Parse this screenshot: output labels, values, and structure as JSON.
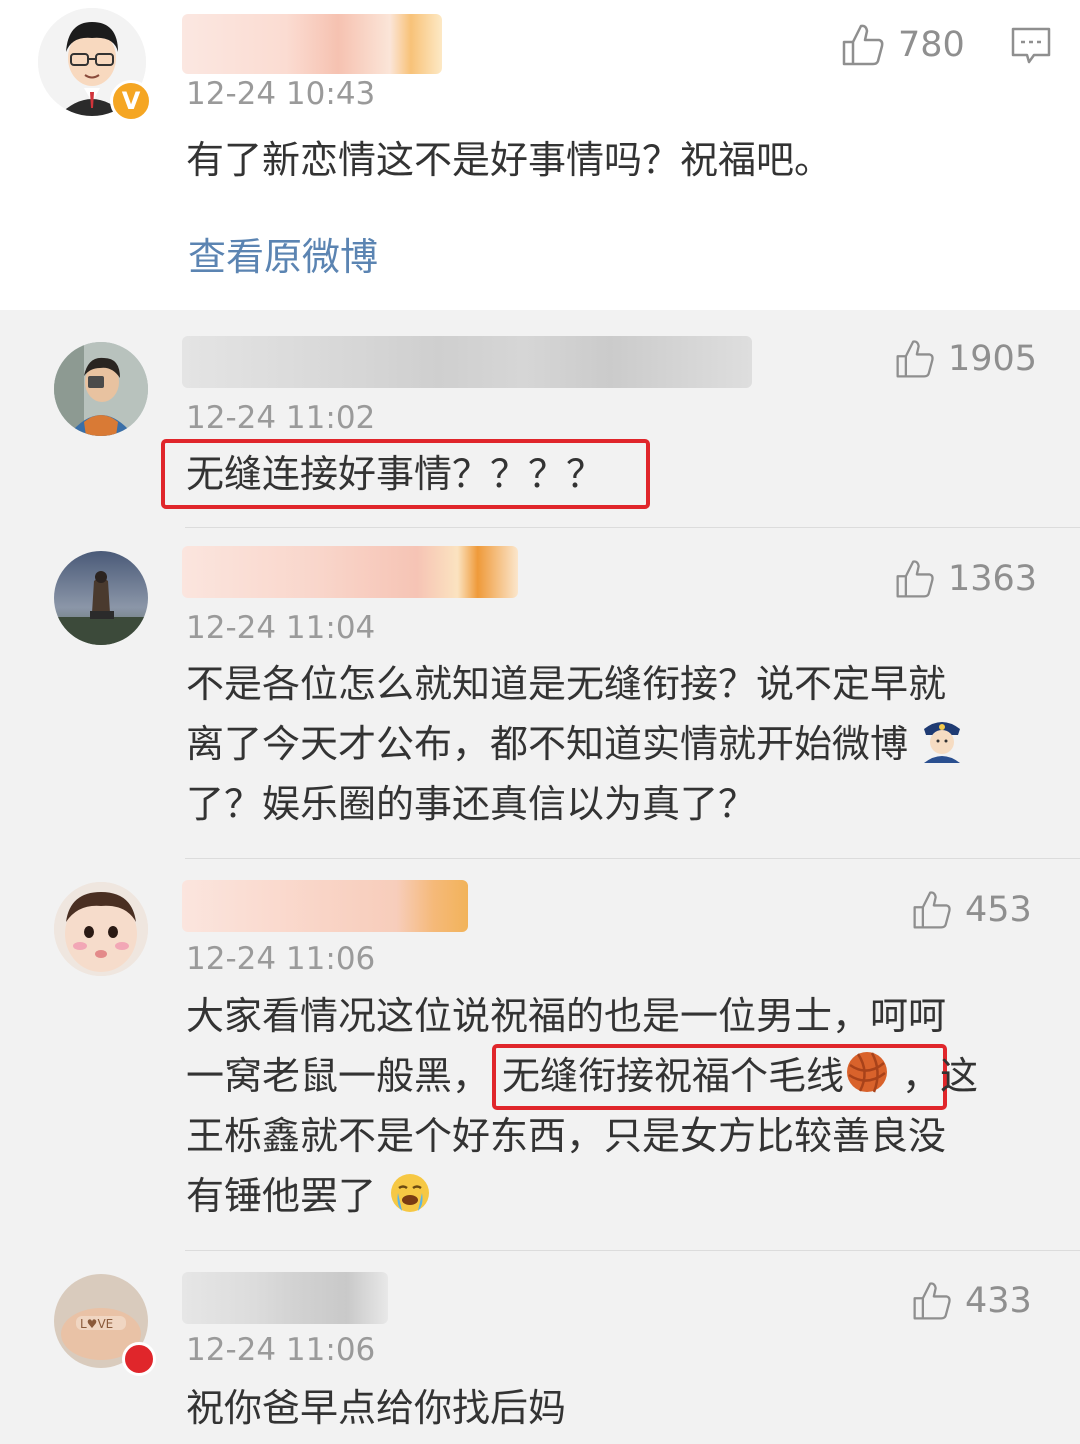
{
  "main_comment": {
    "timestamp": "12-24 10:43",
    "text": "有了新恋情这不是好事情吗？祝福吧。",
    "like_count": "780",
    "view_original_label": "查看原微博",
    "verified_badge": "V"
  },
  "replies": [
    {
      "timestamp": "12-24 11:02",
      "text": "无缝连接好事情？？？？",
      "like_count": "1905",
      "highlighted": true
    },
    {
      "timestamp": "12-24 11:04",
      "lines": [
        "不是各位怎么就知道是无缝衔接？说不定早就",
        "离了今天才公布，都不知道实情就开始微博",
        "了？娱乐圈的事还真信以为真了？"
      ],
      "like_count": "1363",
      "emoji": "police-officer"
    },
    {
      "timestamp": "12-24 11:06",
      "line1": "大家看情况这位说祝福的也是一位男士，呵呵",
      "line2_prefix": "一窝老鼠一般黑，",
      "line2_highlight": "无缝衔接祝福个毛线",
      "line2_suffix": "，这",
      "line3": "王栎鑫就不是个好东西，只是女方比较善良没",
      "line4": "有锤他罢了",
      "like_count": "453",
      "emojis": [
        "yarn-ball",
        "crying-face"
      ]
    },
    {
      "timestamp": "12-24 11:06",
      "text": "祝你爸早点给你找后妈",
      "like_count": "433"
    }
  ],
  "colors": {
    "highlight": "#e0262b",
    "link": "#5b84b2",
    "timestamp": "#9a9a9a",
    "background_replies": "#f2f2f2",
    "verified_badge": "#f5a623"
  }
}
